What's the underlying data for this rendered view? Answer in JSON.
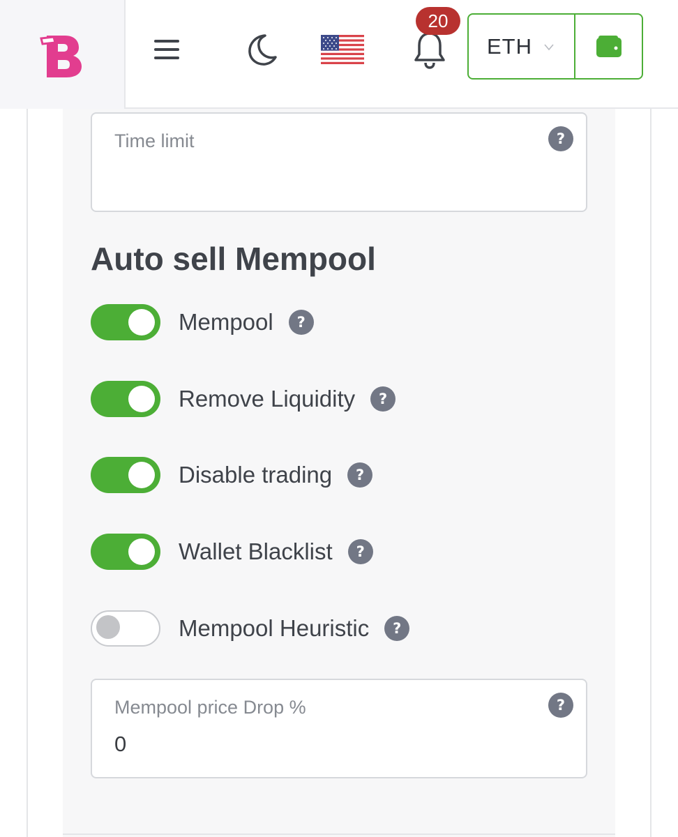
{
  "topbar": {
    "logo_icon": "brand-b-logo",
    "menu_icon": "hamburger-menu-icon",
    "theme_icon": "moon-icon",
    "language_icon": "us-flag-icon",
    "notifications": {
      "icon": "bell-icon",
      "count": "20"
    },
    "network": {
      "selected": "ETH",
      "icon": "chevron-down-icon"
    },
    "wallet_icon": "wallet-icon"
  },
  "colors": {
    "brand_pink": "#e23d8f",
    "accent_green": "#4cae36",
    "badge_red": "#b8322f",
    "help_gray": "#727785"
  },
  "time_limit": {
    "label": "Time limit",
    "value": "",
    "help": "?"
  },
  "section": {
    "title": "Auto sell Mempool"
  },
  "toggles": [
    {
      "label": "Mempool",
      "on": true,
      "help": "?"
    },
    {
      "label": "Remove Liquidity",
      "on": true,
      "help": "?"
    },
    {
      "label": "Disable trading",
      "on": true,
      "help": "?"
    },
    {
      "label": "Wallet Blacklist",
      "on": true,
      "help": "?"
    },
    {
      "label": "Mempool Heuristic",
      "on": false,
      "help": "?"
    }
  ],
  "price_drop": {
    "label": "Mempool price Drop %",
    "value": "0",
    "help": "?"
  }
}
